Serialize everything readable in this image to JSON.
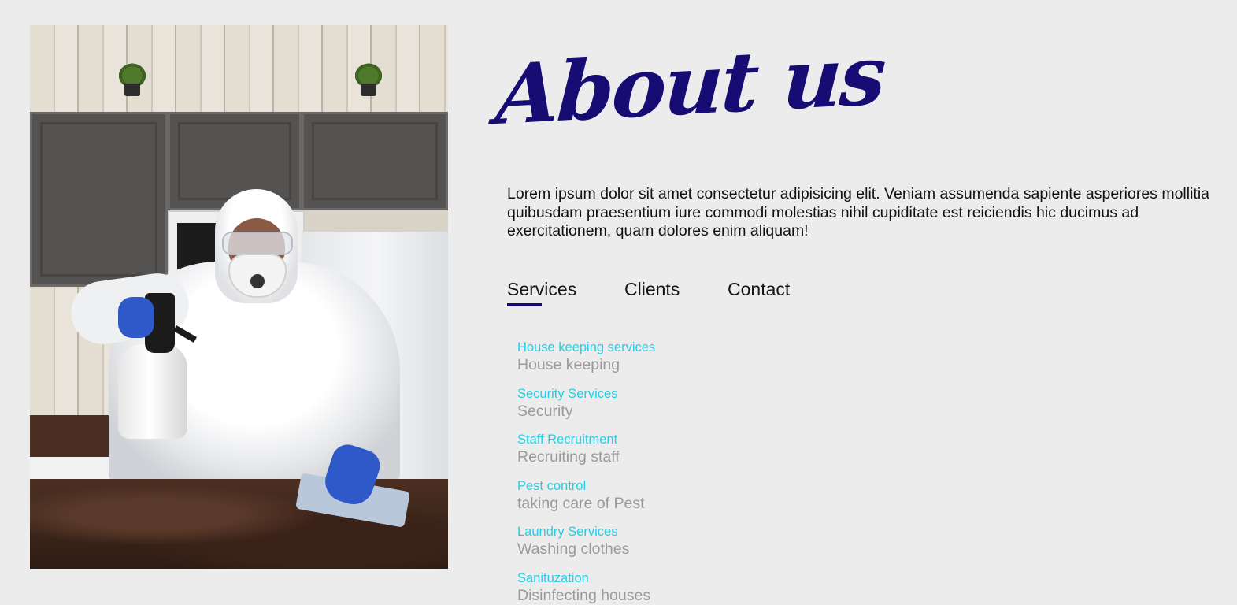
{
  "about": {
    "heading": "About us",
    "intro": "Lorem ipsum dolor sit amet consectetur adipisicing elit. Veniam assumenda sapiente asperiores mollitia quibusdam praesentium iure commodi molestias nihil cupiditate est reiciendis hic ducimus ad exercitationem, quam dolores enim aliquam!"
  },
  "tabs": [
    {
      "label": "Services",
      "active": true
    },
    {
      "label": "Clients",
      "active": false
    },
    {
      "label": "Contact",
      "active": false
    }
  ],
  "services": [
    {
      "title": "House keeping services",
      "description": "House keeping"
    },
    {
      "title": "Security Services",
      "description": "Security"
    },
    {
      "title": "Staff Recruitment",
      "description": "Recruiting staff"
    },
    {
      "title": "Pest control",
      "description": "taking care of Pest"
    },
    {
      "title": "Laundry Services",
      "description": "Washing clothes"
    },
    {
      "title": "Sanituzation",
      "description": "Disinfecting houses"
    }
  ],
  "colors": {
    "background": "#ececec",
    "heading": "#170b74",
    "accent_underline": "#170b74",
    "service_title": "#22cfe6",
    "service_description": "#9a9a9a",
    "body_text": "#111111"
  }
}
